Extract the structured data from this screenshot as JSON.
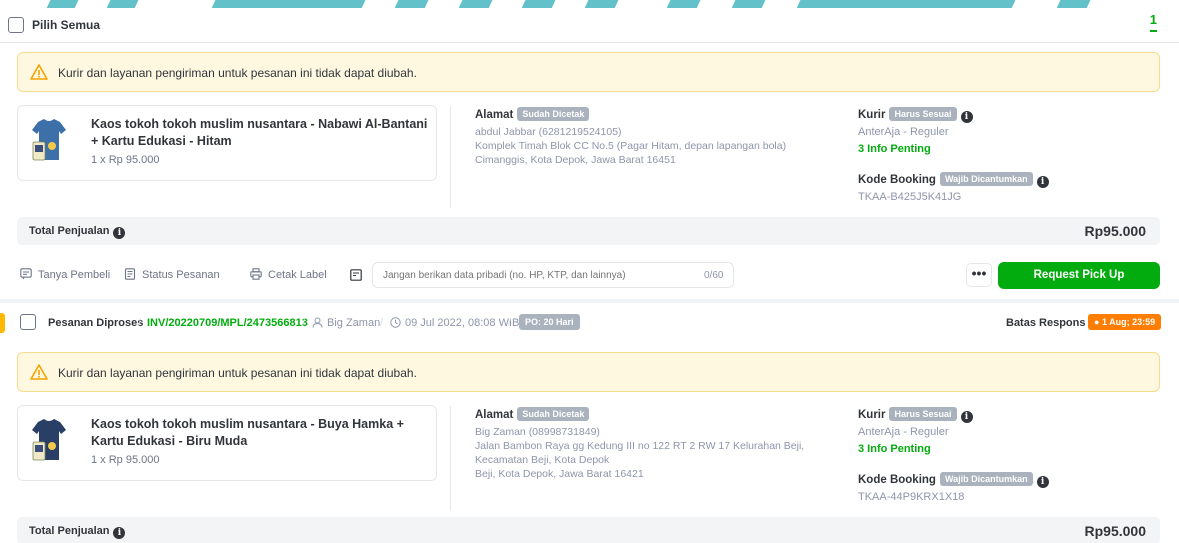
{
  "header": {
    "select_all_label": "Pilih Semua",
    "page_number": "1"
  },
  "warning_text": "Kurir dan layanan pengiriman untuk pesanan ini tidak dapat diubah.",
  "labels": {
    "alamat": "Alamat",
    "sudah_dicetak": "Sudah Dicetak",
    "kurir": "Kurir",
    "harus_sesuai": "Harus Sesuai",
    "info_penting": "3 Info Penting",
    "kode_booking": "Kode Booking",
    "wajib_dicantumkan": "Wajib Dicantumkan",
    "total_penjualan": "Total Penjualan"
  },
  "orders": [
    {
      "product_name": "Kaos tokoh tokoh muslim nusantara - Nabawi Al-Bantani + Kartu Edukasi - Hitam",
      "quantity_price": "1 x Rp 95.000",
      "shirt_color": "#3d6fa8",
      "address": {
        "recipient": "abdul Jabbar (6281219524105)",
        "lines": [
          "Komplek Timah Blok CC No.5 (Pagar Hitam, depan lapangan bola)",
          "Cimanggis, Kota Depok, Jawa Barat 16451"
        ]
      },
      "courier": "AnterAja - Reguler",
      "booking_code": "TKAA-B425J5K41JG",
      "total": "Rp95.000"
    },
    {
      "status": "Pesanan Diproses",
      "invoice": "INV/20220709/MPL/2473566813",
      "buyer": "Big Zaman",
      "date": "09 Jul 2022, 08:08 WIB",
      "po_badge": "PO: 20 Hari",
      "deadline_label": "Batas Respons",
      "deadline_value": "1 Aug; 23:59",
      "product_name": "Kaos tokoh tokoh muslim nusantara - Buya Hamka + Kartu Edukasi - Biru Muda",
      "quantity_price": "1 x Rp 95.000",
      "shirt_color": "#2a3f66",
      "address": {
        "recipient": "Big Zaman (08998731849)",
        "lines": [
          "Jalan Bambon Raya gg Kedung III no 122 RT 2 RW 17 Kelurahan Beji,",
          "Kecamatan Beji, Kota Depok",
          "Beji, Kota Depok, Jawa Barat 16421"
        ]
      },
      "courier": "AnterAja - Reguler",
      "booking_code": "TKAA-44P9KRX1X18",
      "total": "Rp95.000"
    }
  ],
  "actions": {
    "tanya_pembeli": "Tanya Pembeli",
    "status_pesanan": "Status Pesanan",
    "cetak_label": "Cetak Label",
    "note_placeholder": "Jangan berikan data pribadi (no. HP, KTP, dan lainnya)",
    "note_counter": "0/60",
    "more": "•••",
    "request_pickup": "Request Pick Up"
  },
  "colors": {
    "primary_green": "#03ac0e",
    "warning_bg": "#fff8e1",
    "deadline_orange": "#ff7d00",
    "accent_yellow": "#ffb800",
    "top_strip": "#63c2c9"
  }
}
